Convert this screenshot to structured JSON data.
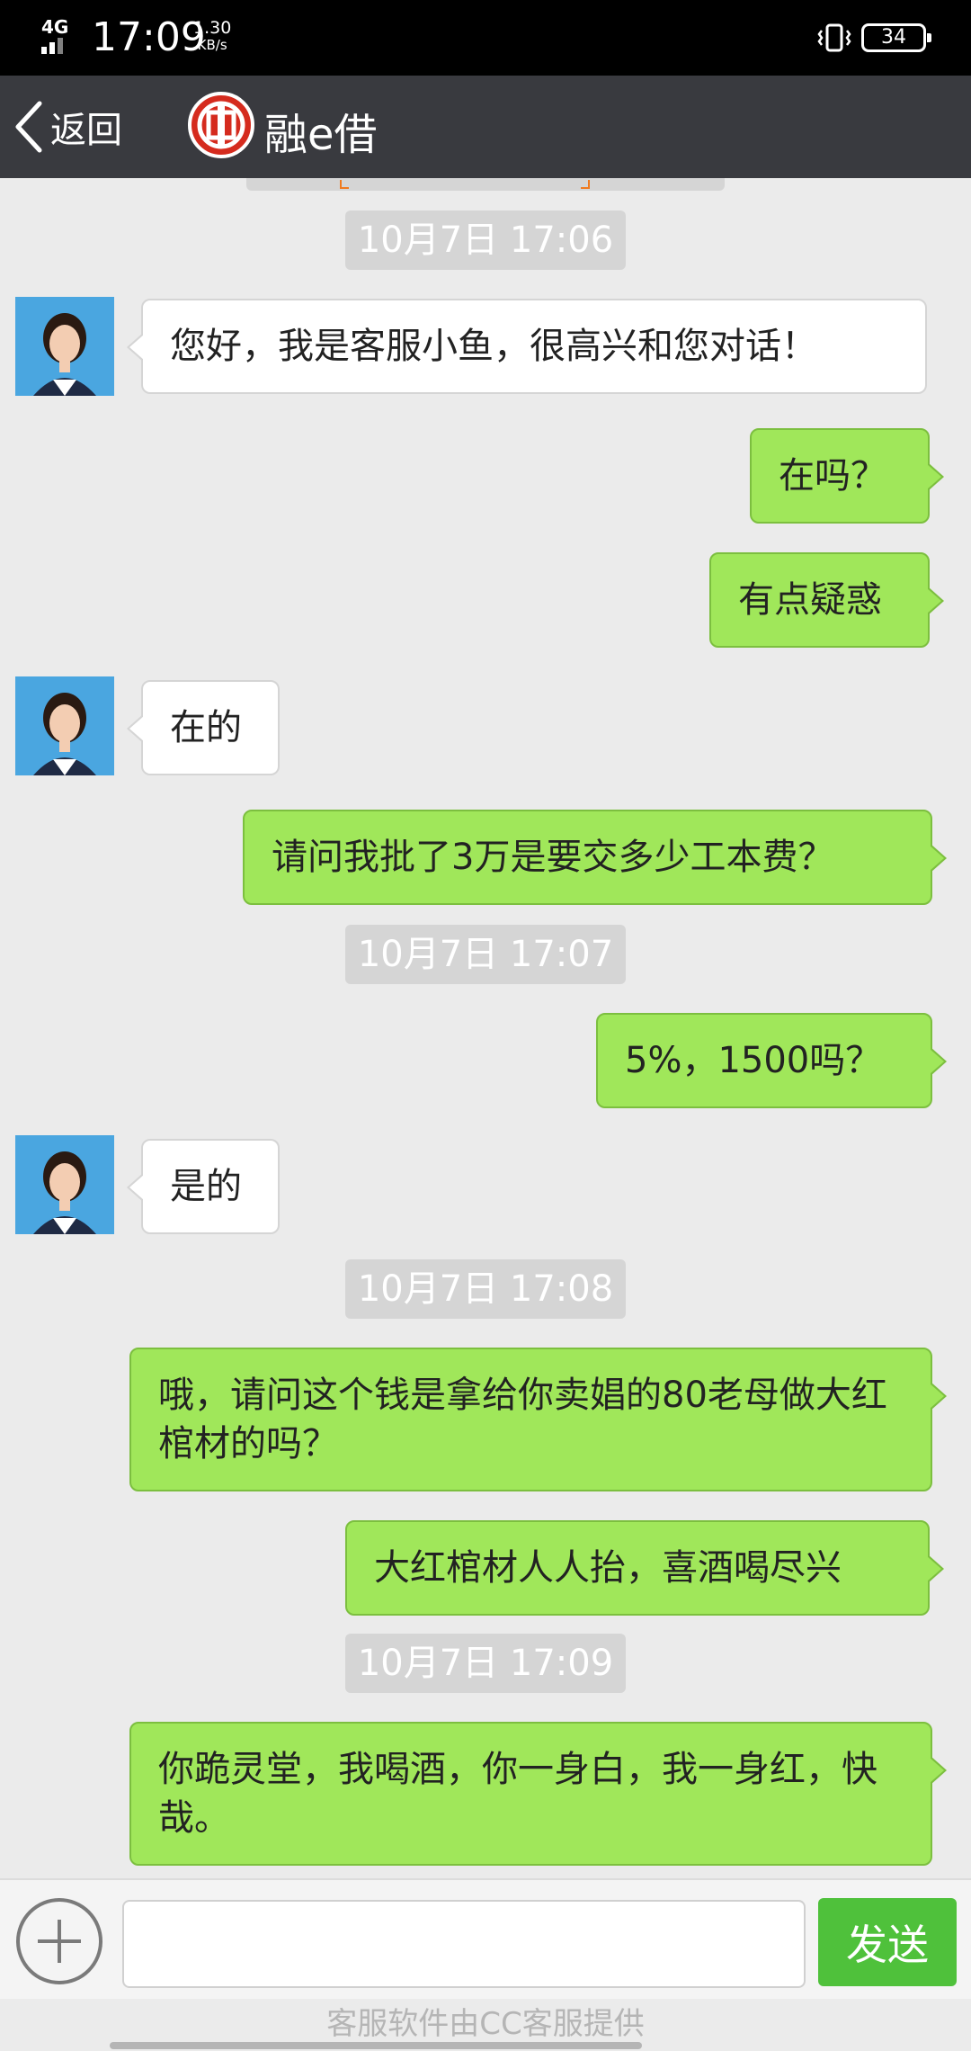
{
  "status_bar": {
    "network": "4G",
    "time": "17:09",
    "speed_value": "1.30",
    "speed_unit": "KB/s",
    "battery": "34"
  },
  "header": {
    "back_label": "返回",
    "logo_icon": "icbc-logo-icon",
    "title": "融e借"
  },
  "colors": {
    "header_bg": "#393a3f",
    "chat_bg": "#ebebeb",
    "out_bubble": "#a0e75a",
    "send_button": "#4fc13b"
  },
  "messages": [
    {
      "kind": "timestamp",
      "text": "10月7日 17:06"
    },
    {
      "kind": "in",
      "text": "您好，我是客服小鱼，很高兴和您对话！"
    },
    {
      "kind": "out",
      "text": "在吗？"
    },
    {
      "kind": "out",
      "text": "有点疑惑"
    },
    {
      "kind": "in",
      "text": "在的"
    },
    {
      "kind": "out",
      "text": "请问我批了3万是要交多少工本费？"
    },
    {
      "kind": "timestamp",
      "text": "10月7日 17:07"
    },
    {
      "kind": "out",
      "text": "5%，1500吗？"
    },
    {
      "kind": "in",
      "text": "是的"
    },
    {
      "kind": "timestamp",
      "text": "10月7日 17:08"
    },
    {
      "kind": "out",
      "text": "哦，请问这个钱是拿给你卖娼的80老母做大红棺材的吗？"
    },
    {
      "kind": "out",
      "text": "大红棺材人人抬，喜酒喝尽兴"
    },
    {
      "kind": "timestamp",
      "text": "10月7日 17:09"
    },
    {
      "kind": "out",
      "text": "你跪灵堂，我喝酒，你一身白，我一身红，快哉。"
    }
  ],
  "input_bar": {
    "placeholder": "",
    "send_label": "发送"
  },
  "footer": {
    "text": "客服软件由CC客服提供"
  }
}
